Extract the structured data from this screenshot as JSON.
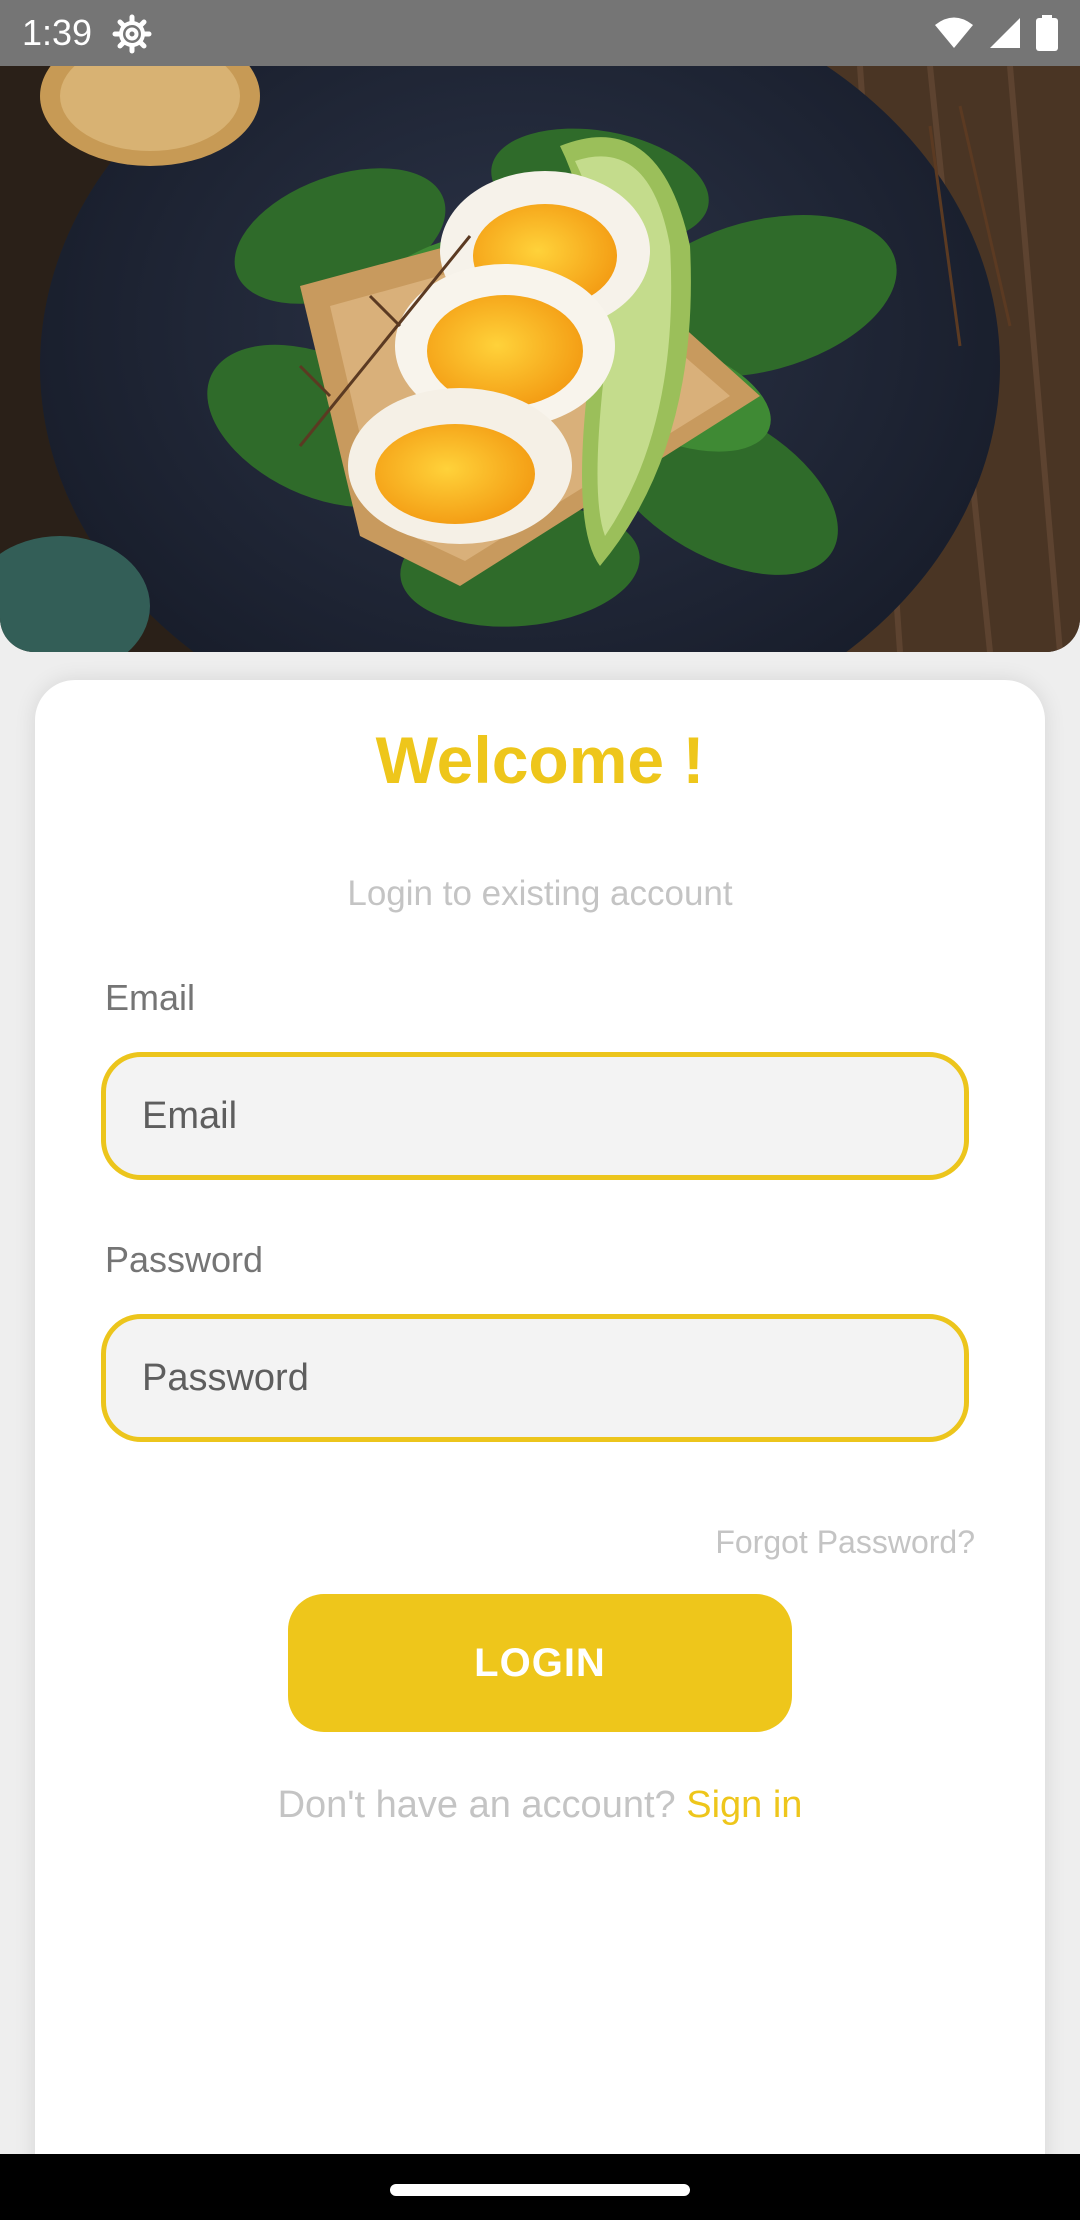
{
  "status_bar": {
    "time": "1:39",
    "icons": [
      "gear-icon",
      "wifi-icon",
      "signal-icon",
      "battery-icon"
    ]
  },
  "hero": {
    "image": "food-photo-eggs-avocado-toast"
  },
  "login": {
    "title": "Welcome !",
    "subtitle": "Login to existing account",
    "email_label": "Email",
    "email_placeholder": "Email",
    "email_value": "",
    "password_label": "Password",
    "password_placeholder": "Password",
    "password_value": "",
    "forgot_password": "Forgot Password?",
    "login_button": "LOGIN",
    "no_account_text": "Don't have an account? ",
    "signin_link": "Sign in"
  },
  "colors": {
    "accent": "#eec61b",
    "muted_text": "#c4c4c4",
    "label_text": "#757575",
    "input_bg": "#f3f3f3",
    "status_bar": "#757575",
    "nav_bar": "#000000"
  }
}
